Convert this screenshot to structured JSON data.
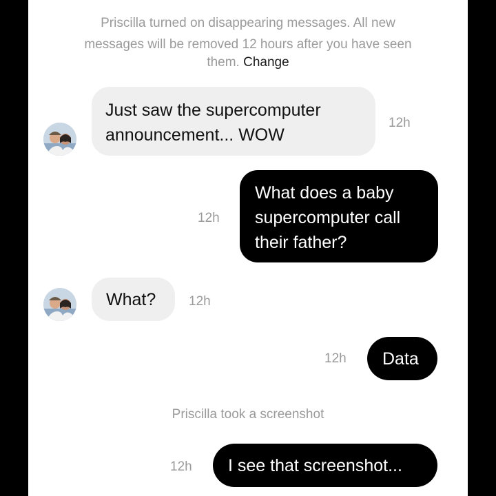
{
  "notice": {
    "line1": "Priscilla turned on disappearing messages. All new",
    "line2": "messages will be removed 12 hours after you have seen",
    "line3_prefix": "them.",
    "change_label": "Change"
  },
  "messages": [
    {
      "direction": "incoming",
      "lines": [
        "Just saw the supercomputer",
        "announcement... WOW"
      ],
      "time": "12h"
    },
    {
      "direction": "outgoing",
      "lines": [
        "What does a baby",
        "supercomputer call",
        "their father?"
      ],
      "time": "12h"
    },
    {
      "direction": "incoming",
      "lines": [
        "What?"
      ],
      "time": "12h"
    },
    {
      "direction": "outgoing",
      "lines": [
        "Data"
      ],
      "time": "12h"
    },
    {
      "direction": "outgoing",
      "lines": [
        "I see that screenshot..."
      ],
      "time": "12h"
    }
  ],
  "screenshot_notice": "Priscilla took a screenshot",
  "colors": {
    "background": "#000000",
    "panel": "#ffffff",
    "incoming_bubble": "#efefef",
    "outgoing_bubble": "#000000",
    "meta_text": "#9a9a9a"
  },
  "icons": {
    "avatar": "profile-photo-two-people"
  }
}
